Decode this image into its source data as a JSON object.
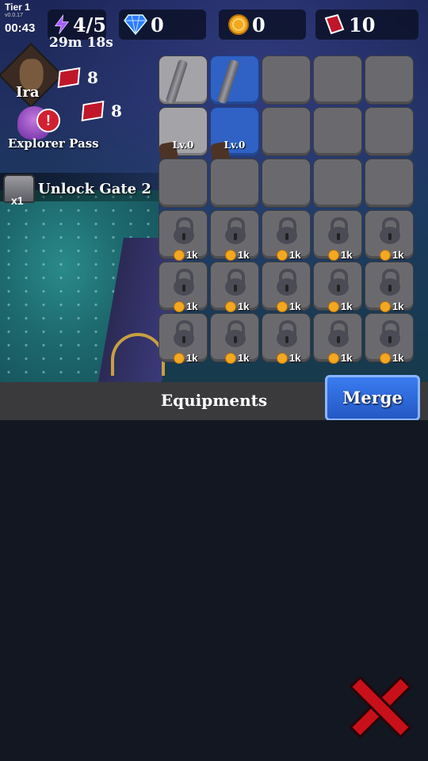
{
  "header": {
    "tier": "Tier 1",
    "version": "v0.0.17",
    "clock": "00:43",
    "energy": "4/5",
    "energy_timer": "29m 18s",
    "diamonds": "0",
    "coins": "0",
    "gems": "10"
  },
  "left_panel": {
    "hero_name": "Ira",
    "hero_gems": "8",
    "pass_gems": "8",
    "pass_alert": "!",
    "pass_label": "Explorer Pass",
    "chest_count": "x1",
    "gate_label": "Unlock Gate 2"
  },
  "grid": {
    "item_level_label": "Lv.0",
    "locked_cost": "1k"
  },
  "bottom": {
    "title": "Equipments",
    "merge_label": "Merge"
  },
  "colors": {
    "accent_blue": "#2f62c4",
    "close_red": "#c8101a",
    "panel_bg": "#121722"
  }
}
